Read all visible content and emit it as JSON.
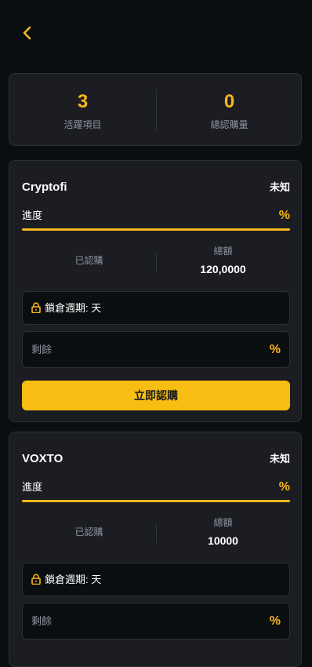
{
  "header": {
    "back_icon": "chevron-left-icon",
    "accent_color": "#f7b71a"
  },
  "stats": {
    "active_projects": {
      "value": "3",
      "label": "活躍項目"
    },
    "total_subscribed": {
      "value": "0",
      "label": "總認購量"
    }
  },
  "projects": [
    {
      "name": "Cryptofi",
      "status": "未知",
      "progress_label": "進度",
      "progress_pct_text": "%",
      "progress_fraction": 1,
      "subscribed_label": "已認購",
      "total_label": "總額",
      "total_value": "120,0000",
      "lock_icon": "lock-icon",
      "lock_text": "鎖倉週期: 天",
      "remaining_label": "剩餘",
      "remaining_pct_text": "%",
      "button_label": "立即認購"
    },
    {
      "name": "VOXTO",
      "status": "未知",
      "progress_label": "進度",
      "progress_pct_text": "%",
      "progress_fraction": 1,
      "subscribed_label": "已認購",
      "total_label": "總額",
      "total_value": "10000",
      "lock_icon": "lock-icon",
      "lock_text": "鎖倉週期: 天",
      "remaining_label": "剩餘",
      "remaining_pct_text": "%"
    }
  ]
}
